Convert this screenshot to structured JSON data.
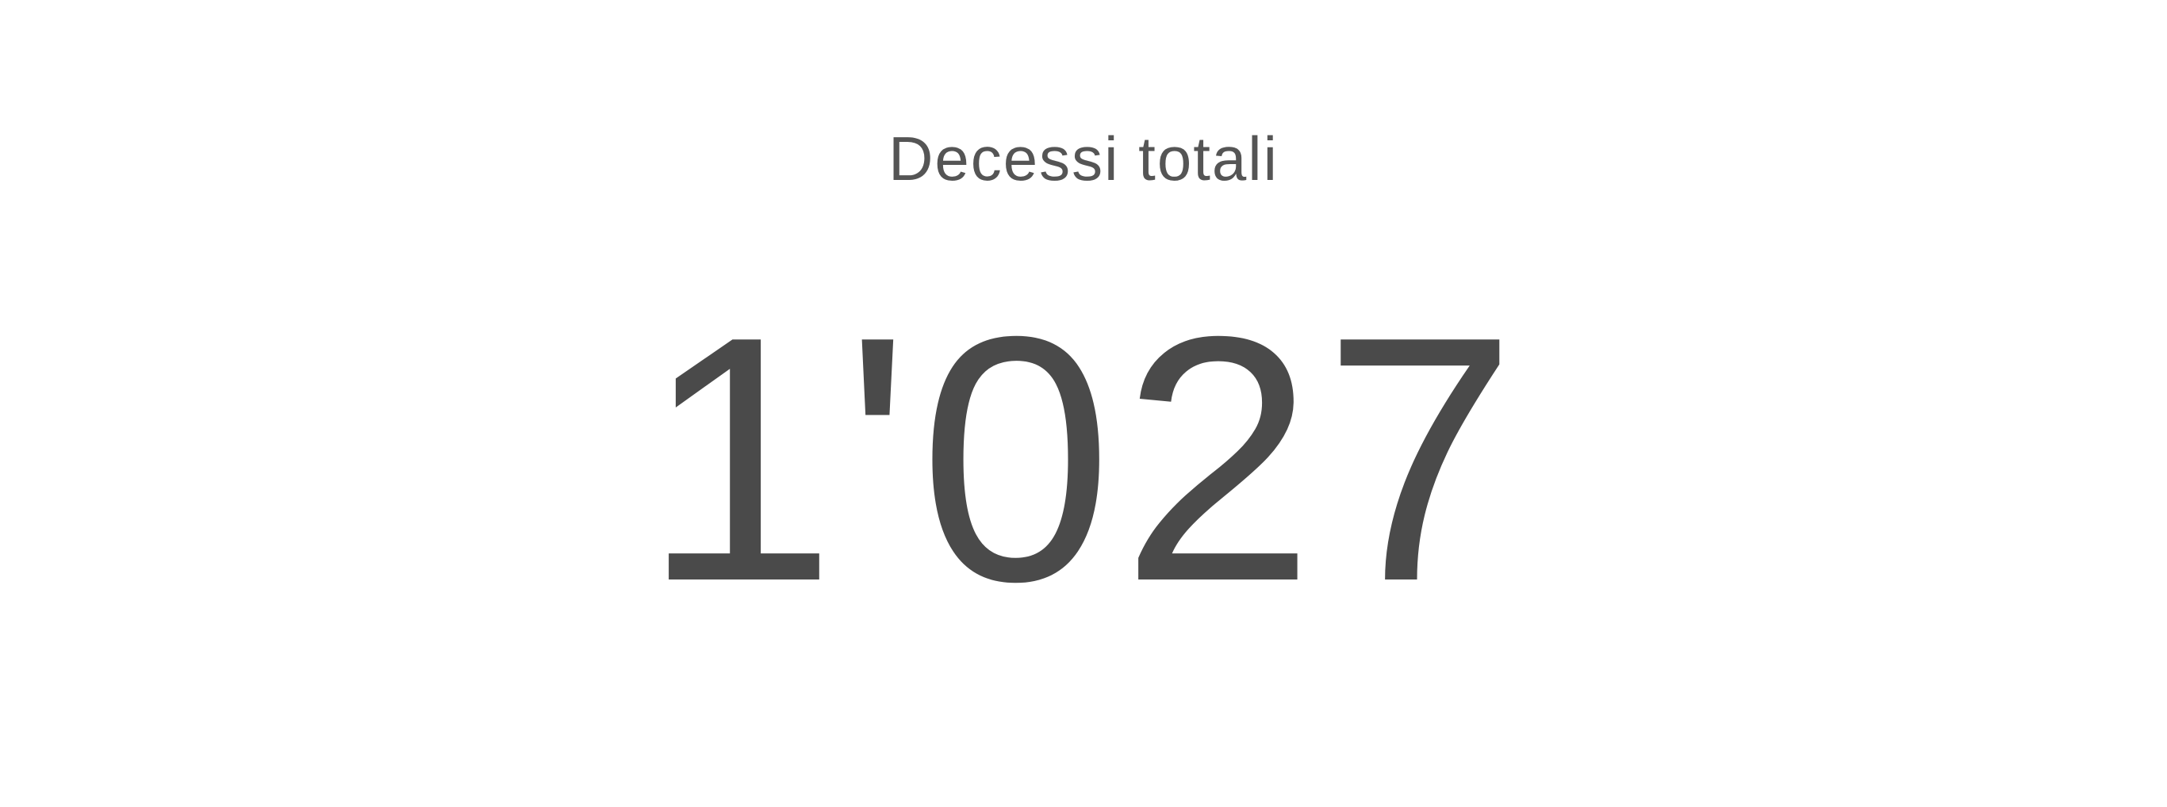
{
  "stat": {
    "title": "Decessi totali",
    "value": "1'027"
  },
  "colors": {
    "text": "#4a4a4a",
    "background": "#ffffff"
  }
}
